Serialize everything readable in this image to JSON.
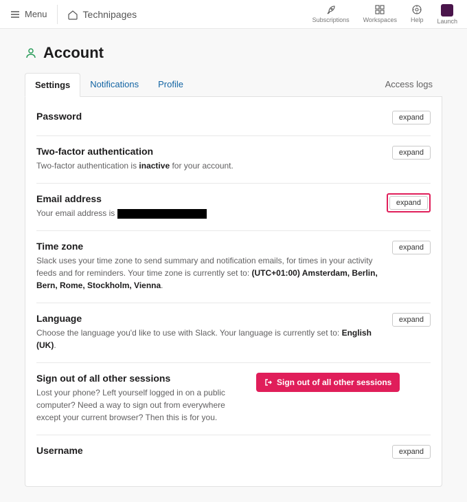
{
  "topbar": {
    "menu_label": "Menu",
    "workspace_name": "Technipages",
    "items": {
      "subscriptions": "Subscriptions",
      "workspaces": "Workspaces",
      "help": "Help",
      "launch": "Launch"
    }
  },
  "page": {
    "title": "Account",
    "tabs": {
      "settings": "Settings",
      "notifications": "Notifications",
      "profile": "Profile",
      "access_logs": "Access logs"
    }
  },
  "sections": {
    "password": {
      "title": "Password",
      "expand": "expand"
    },
    "twofa": {
      "title": "Two-factor authentication",
      "desc_pre": "Two-factor authentication is ",
      "status": "inactive",
      "desc_post": " for your account.",
      "expand": "expand"
    },
    "email": {
      "title": "Email address",
      "desc": "Your email address is ",
      "expand": "expand"
    },
    "tz": {
      "title": "Time zone",
      "desc_pre": "Slack uses your time zone to send summary and notification emails, for times in your activity feeds and for reminders. Your time zone is currently set to: ",
      "value": "(UTC+01:00) Amsterdam, Berlin, Bern, Rome, Stockholm, Vienna",
      "period": ".",
      "expand": "expand"
    },
    "lang": {
      "title": "Language",
      "desc_pre": "Choose the language you'd like to use with Slack. Your language is currently set to: ",
      "value": "English (UK)",
      "period": ".",
      "expand": "expand"
    },
    "signout": {
      "title": "Sign out of all other sessions",
      "desc": "Lost your phone? Left yourself logged in on a public computer? Need a way to sign out from everywhere except your current browser? Then this is for you.",
      "button": "Sign out of all other sessions"
    },
    "username": {
      "title": "Username",
      "expand": "expand"
    }
  }
}
